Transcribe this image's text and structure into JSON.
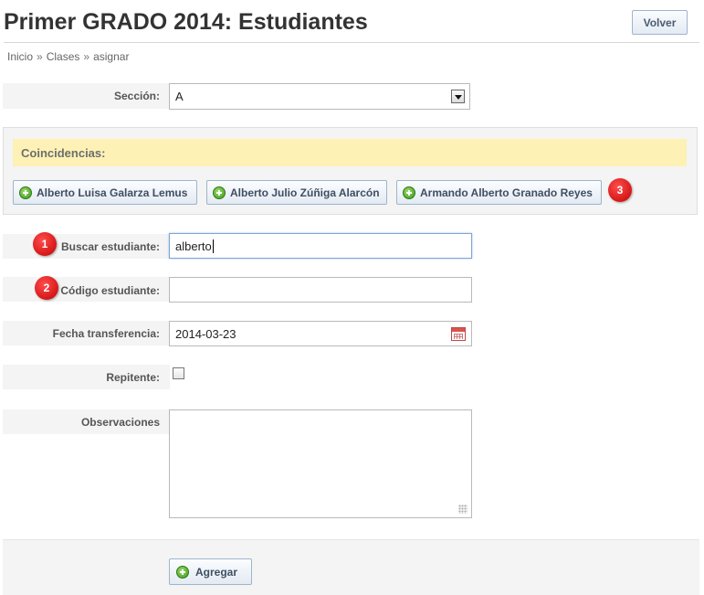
{
  "header": {
    "title": "Primer GRADO 2014: Estudiantes",
    "back_button": "Volver"
  },
  "breadcrumb": {
    "items": [
      "Inicio",
      "Clases",
      "asignar"
    ],
    "separator": "»"
  },
  "form": {
    "seccion": {
      "label": "Sección:",
      "value": "A"
    },
    "coincidencias": {
      "title": "Coincidencias:",
      "matches": [
        "Alberto Luisa Galarza Lemus",
        "Alberto Julio Zúñiga Alarcón",
        "Armando Alberto Granado Reyes"
      ]
    },
    "buscar": {
      "label": "Buscar estudiante:",
      "value": "alberto"
    },
    "codigo": {
      "label": "Código estudiante:",
      "value": ""
    },
    "fecha": {
      "label": "Fecha transferencia:",
      "value": "2014-03-23"
    },
    "repitente": {
      "label": "Repitente:",
      "checked": false
    },
    "observaciones": {
      "label": "Observaciones",
      "value": ""
    },
    "submit_label": "Agregar"
  },
  "annotations": [
    "1",
    "2",
    "3"
  ],
  "colors": {
    "highlight": "#fdf1b5",
    "annotation_red": "#d10000",
    "plus_green": "#4caf24"
  }
}
